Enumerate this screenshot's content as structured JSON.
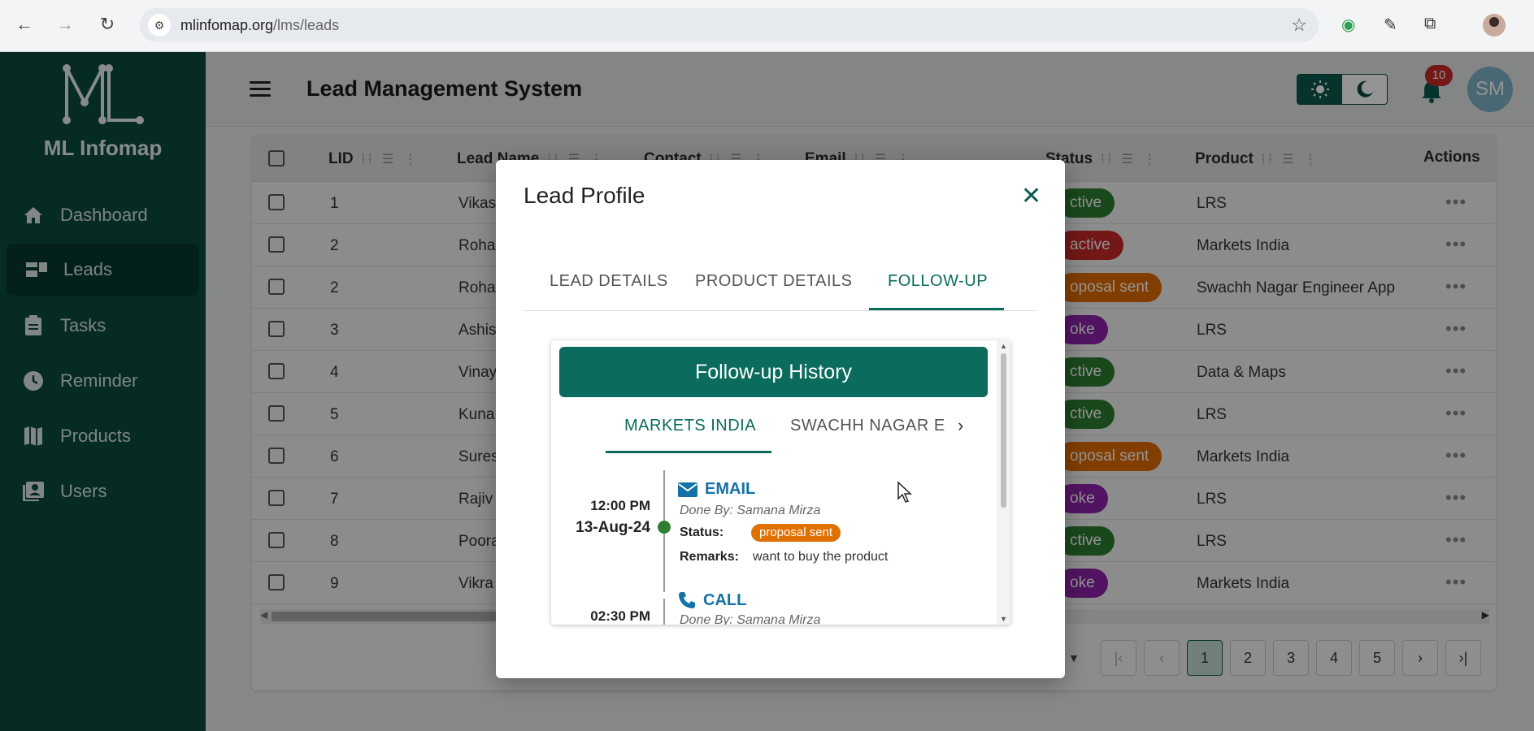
{
  "browser": {
    "url_host": "mlinfomap.org",
    "url_path": "/lms/leads"
  },
  "sidebar": {
    "logo_text": "ML Infomap",
    "items": [
      {
        "label": "Dashboard",
        "icon": "home-icon",
        "active": false
      },
      {
        "label": "Leads",
        "icon": "leads-icon",
        "active": true
      },
      {
        "label": "Tasks",
        "icon": "clipboard-icon",
        "active": false
      },
      {
        "label": "Reminder",
        "icon": "clock-icon",
        "active": false
      },
      {
        "label": "Products",
        "icon": "map-icon",
        "active": false
      },
      {
        "label": "Users",
        "icon": "user-card-icon",
        "active": false
      }
    ]
  },
  "header": {
    "title": "Lead Management System",
    "notification_count": "10",
    "avatar_initials": "SM"
  },
  "table": {
    "columns": [
      "LID",
      "Lead Name",
      "Contact",
      "Email",
      "Status",
      "Product",
      "Actions"
    ],
    "rows": [
      {
        "lid": "1",
        "name": "Vikas",
        "status": "ctive",
        "status_color": "#2e7d32",
        "product": "LRS"
      },
      {
        "lid": "2",
        "name": "Roha",
        "status": "active",
        "status_color": "#c62828",
        "product": "Markets India"
      },
      {
        "lid": "2",
        "name": "Roha",
        "status": "oposal sent",
        "status_color": "#e06c00",
        "product": "Swachh Nagar Engineer App"
      },
      {
        "lid": "3",
        "name": "Ashis",
        "status": "oke",
        "status_color": "#8e24aa",
        "product": "LRS"
      },
      {
        "lid": "4",
        "name": "Vinay",
        "status": "ctive",
        "status_color": "#2e7d32",
        "product": "Data & Maps"
      },
      {
        "lid": "5",
        "name": "Kuna",
        "status": "ctive",
        "status_color": "#2e7d32",
        "product": "LRS"
      },
      {
        "lid": "6",
        "name": "Sures",
        "status": "oposal sent",
        "status_color": "#e06c00",
        "product": "Markets India"
      },
      {
        "lid": "7",
        "name": "Rajiv",
        "status": "oke",
        "status_color": "#8e24aa",
        "product": "LRS"
      },
      {
        "lid": "8",
        "name": "Poora",
        "status": "ctive",
        "status_color": "#2e7d32",
        "product": "LRS"
      },
      {
        "lid": "9",
        "name": "Vikra",
        "status": "oke",
        "status_color": "#8e24aa",
        "product": "Markets India"
      }
    ],
    "actions_glyph": "•••"
  },
  "pagination": {
    "first": "|‹",
    "prev": "‹",
    "pages": [
      "1",
      "2",
      "3",
      "4",
      "5"
    ],
    "current": "1",
    "next": "›",
    "last": "›|"
  },
  "modal": {
    "title": "Lead Profile",
    "tabs": [
      "LEAD DETAILS",
      "PRODUCT DETAILS",
      "FOLLOW-UP"
    ],
    "active_tab": "FOLLOW-UP",
    "followup": {
      "header": "Follow-up History",
      "product_tabs": [
        "MARKETS INDIA",
        "SWACHH NAGAR E"
      ],
      "events": [
        {
          "time": "12:00 PM",
          "date": "13-Aug-24",
          "type": "EMAIL",
          "done_by": "Done By: Samana Mirza",
          "status_label": "Status:",
          "status": "proposal sent",
          "remarks_label": "Remarks:",
          "remarks": "want to buy the product"
        },
        {
          "time": "02:30 PM",
          "type": "CALL",
          "done_by": "Done By: Samana Mirza"
        }
      ]
    }
  },
  "colors": {
    "primary": "#0b6b5c",
    "sidebar": "#0b4a40",
    "link": "#1572a8",
    "proposal_chip": "#e07000"
  }
}
